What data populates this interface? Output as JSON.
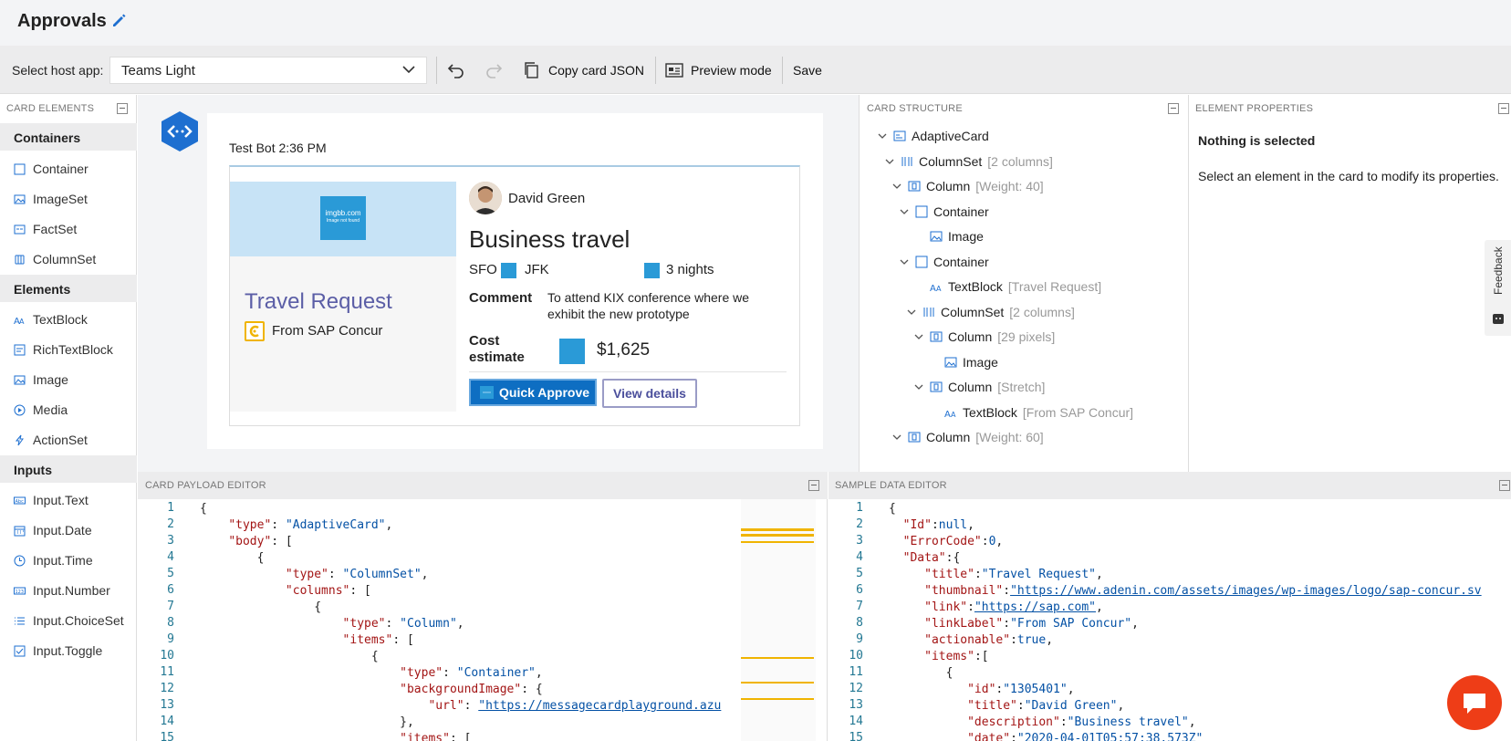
{
  "app": {
    "title": "Approvals"
  },
  "toolbar": {
    "host_label": "Select host app:",
    "host_value": "Teams Light",
    "copy_json": "Copy card JSON",
    "preview_mode": "Preview mode",
    "save": "Save"
  },
  "palette": {
    "header": "CARD ELEMENTS",
    "groups": [
      {
        "label": "Containers",
        "items": [
          "Container",
          "ImageSet",
          "FactSet",
          "ColumnSet"
        ]
      },
      {
        "label": "Elements",
        "items": [
          "TextBlock",
          "RichTextBlock",
          "Image",
          "Media",
          "ActionSet"
        ]
      },
      {
        "label": "Inputs",
        "items": [
          "Input.Text",
          "Input.Date",
          "Input.Time",
          "Input.Number",
          "Input.ChoiceSet",
          "Input.Toggle"
        ]
      }
    ]
  },
  "preview": {
    "sender": "Test Bot 2:36 PM",
    "imgbb_title": "imgbb.com",
    "imgbb_sub": "Image not found",
    "travel_request": "Travel Request",
    "from_sap": "From SAP Concur",
    "person_name": "David Green",
    "title": "Business travel",
    "from": "SFO",
    "to": "JFK",
    "nights": "3 nights",
    "comment_label": "Comment",
    "comment_text": "To attend KIX conference where we exhibit the new prototype",
    "cost_label": "Cost estimate",
    "cost_value": "$1,625",
    "approve_btn": "Quick Approve",
    "view_btn": "View details"
  },
  "structure": {
    "header": "CARD STRUCTURE",
    "rows": [
      {
        "label": "AdaptiveCard",
        "meta": "",
        "icon": "card-icon"
      },
      {
        "label": "ColumnSet",
        "meta": "[2 columns]",
        "icon": "columnset-icon"
      },
      {
        "label": "Column",
        "meta": "[Weight: 40]",
        "icon": "column-icon"
      },
      {
        "label": "Container",
        "meta": "",
        "icon": "container-icon"
      },
      {
        "label": "Image",
        "meta": "",
        "icon": "image-icon"
      },
      {
        "label": "Container",
        "meta": "",
        "icon": "container-icon"
      },
      {
        "label": "TextBlock",
        "meta": "[Travel Request]",
        "icon": "textblock-icon"
      },
      {
        "label": "ColumnSet",
        "meta": "[2 columns]",
        "icon": "columnset-icon"
      },
      {
        "label": "Column",
        "meta": "[29 pixels]",
        "icon": "column-icon"
      },
      {
        "label": "Image",
        "meta": "",
        "icon": "image-icon"
      },
      {
        "label": "Column",
        "meta": "[Stretch]",
        "icon": "column-icon"
      },
      {
        "label": "TextBlock",
        "meta": "[From SAP Concur]",
        "icon": "textblock-icon"
      },
      {
        "label": "Column",
        "meta": "[Weight: 60]",
        "icon": "column-icon"
      }
    ]
  },
  "properties": {
    "header": "ELEMENT PROPERTIES",
    "nothing": "Nothing is selected",
    "hint": "Select an element in the card to modify its properties.",
    "feedback": "Feedback"
  },
  "payload_editor": {
    "header": "CARD PAYLOAD EDITOR",
    "line_numbers": [
      "1",
      "2",
      "3",
      "4",
      "5",
      "6",
      "7",
      "8",
      "9",
      "10",
      "11",
      "12",
      "13",
      "14",
      "15"
    ]
  },
  "sample_editor": {
    "header": "SAMPLE DATA EDITOR",
    "line_numbers": [
      "1",
      "2",
      "3",
      "4",
      "5",
      "6",
      "7",
      "8",
      "9",
      "10",
      "11",
      "12",
      "13",
      "14",
      "15"
    ]
  },
  "colors": {
    "accent": "#0e6ec2",
    "link": "#5b5ea6",
    "chat": "#ee3d17"
  }
}
